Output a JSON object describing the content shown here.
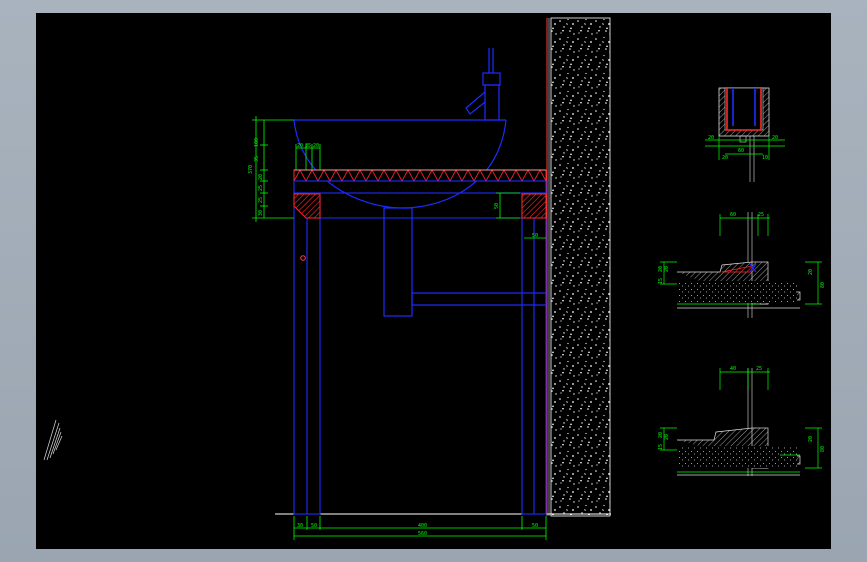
{
  "drawing": {
    "colors": {
      "background": "#000000",
      "frame": "#a3adb8",
      "outline": "#1d2cff",
      "dimension": "#00ff00",
      "hatch": "#ff2a2a",
      "white": "#ffffff",
      "aux_red": "#ff3b3b"
    },
    "left_dims": [
      "100",
      "35",
      "370",
      "20",
      "25",
      "25",
      "30"
    ],
    "top_dims": [
      "20",
      "35",
      "20"
    ],
    "mid_dims": [
      "50",
      "50"
    ],
    "bottom_dims": {
      "row1": [
        "30",
        "50",
        "400",
        "50"
      ],
      "row2": [
        "560"
      ]
    },
    "detail_top": {
      "dims": [
        "20",
        "60",
        "20",
        "20",
        "10"
      ]
    },
    "detail_mid": {
      "top_dims": [
        "60",
        "25"
      ],
      "left_dims": [
        "20",
        "20",
        "15"
      ],
      "right_dims": [
        "20",
        "80"
      ]
    },
    "detail_bottom": {
      "top_dims": [
        "40",
        "25"
      ],
      "left_dims": [
        "20",
        "20",
        "15"
      ],
      "right_dims": [
        "20",
        "80"
      ]
    }
  }
}
